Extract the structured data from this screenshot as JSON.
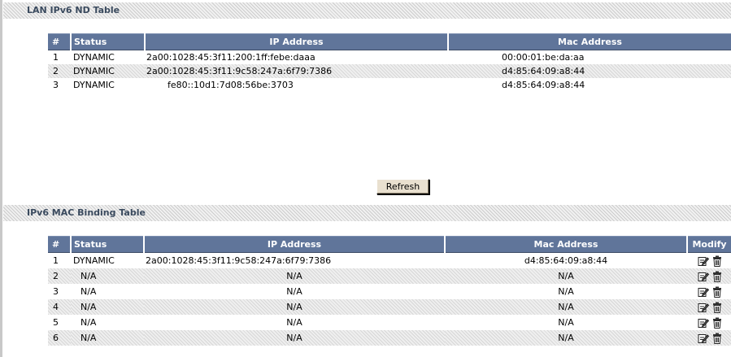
{
  "nd_section": {
    "title": "LAN IPv6 ND Table",
    "columns": {
      "num": "#",
      "status": "Status",
      "ip": "IP Address",
      "mac": "Mac Address"
    },
    "rows": [
      {
        "num": "1",
        "status": "DYNAMIC",
        "ip": "2a00:1028:45:3f11:200:1ff:febe:daaa",
        "mac": "00:00:01:be:da:aa"
      },
      {
        "num": "2",
        "status": "DYNAMIC",
        "ip": "2a00:1028:45:3f11:9c58:247a:6f79:7386",
        "mac": "d4:85:64:09:a8:44"
      },
      {
        "num": "3",
        "status": "DYNAMIC",
        "ip": "fe80::10d1:7d08:56be:3703",
        "mac": "d4:85:64:09:a8:44"
      }
    ],
    "refresh_label": "Refresh"
  },
  "binding_section": {
    "title": "IPv6 MAC Binding Table",
    "columns": {
      "num": "#",
      "status": "Status",
      "ip": "IP Address",
      "mac": "Mac Address",
      "modify": "Modify"
    },
    "rows": [
      {
        "num": "1",
        "status": "DYNAMIC",
        "ip": "2a00:1028:45:3f11:9c58:247a:6f79:7386",
        "mac": "d4:85:64:09:a8:44"
      },
      {
        "num": "2",
        "status": "N/A",
        "ip": "N/A",
        "mac": "N/A"
      },
      {
        "num": "3",
        "status": "N/A",
        "ip": "N/A",
        "mac": "N/A"
      },
      {
        "num": "4",
        "status": "N/A",
        "ip": "N/A",
        "mac": "N/A"
      },
      {
        "num": "5",
        "status": "N/A",
        "ip": "N/A",
        "mac": "N/A"
      },
      {
        "num": "6",
        "status": "N/A",
        "ip": "N/A",
        "mac": "N/A"
      }
    ],
    "icons": {
      "edit": "edit-icon",
      "delete": "trash-icon"
    }
  },
  "colors": {
    "header_bg": "#60759a",
    "section_title": "#3a4a5e",
    "button_bg": "#e9e0cf"
  }
}
